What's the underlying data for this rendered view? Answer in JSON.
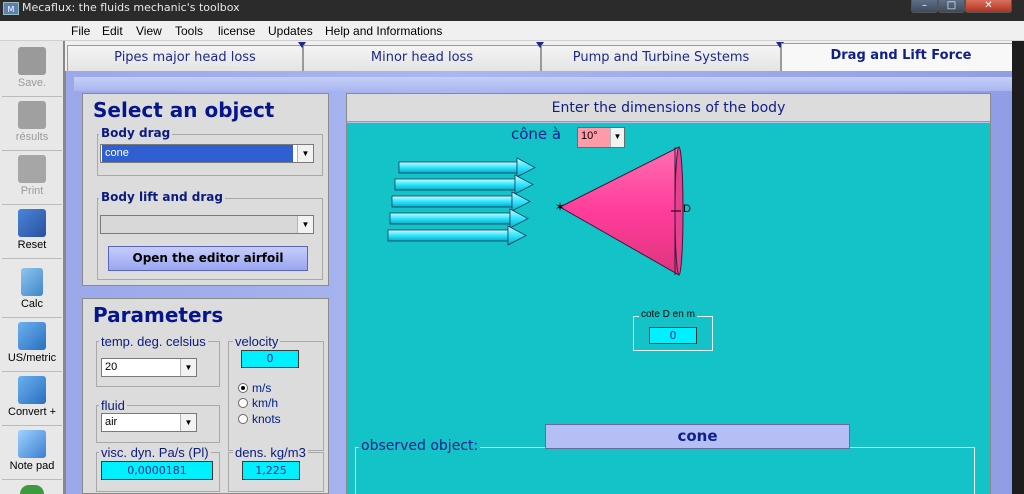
{
  "window": {
    "title": "Mecaflux: the fluids mechanic's toolbox",
    "icon_text": "M"
  },
  "menu": [
    "File",
    "Edit",
    "View",
    "Tools",
    "license",
    "Updates",
    "Help and Informations"
  ],
  "toolbar": [
    {
      "label": "Save.",
      "icon": "save-icon",
      "enabled": false
    },
    {
      "label": "résults",
      "icon": "results-icon",
      "enabled": false
    },
    {
      "label": "Print",
      "icon": "print-icon",
      "enabled": false
    },
    {
      "label": "Reset",
      "icon": "reset-icon",
      "enabled": true
    },
    {
      "label": "Calc",
      "icon": "calculator-icon",
      "enabled": true
    },
    {
      "label": "US/metric",
      "icon": "us-metric-icon",
      "enabled": true
    },
    {
      "label": "Convert +",
      "icon": "convert-icon",
      "enabled": true
    },
    {
      "label": "Note pad",
      "icon": "notepad-icon",
      "enabled": true
    }
  ],
  "tabs": [
    {
      "label": "Pipes major head loss",
      "active": false
    },
    {
      "label": "Minor head loss",
      "active": false
    },
    {
      "label": "Pump and Turbine Systems",
      "active": false
    },
    {
      "label": "Drag and Lift Force",
      "active": true
    }
  ],
  "select_object": {
    "title": "Select an object",
    "body_drag_label": "Body drag",
    "body_drag_value": "cone",
    "body_lift_label": "Body lift and drag",
    "body_lift_value": "",
    "editor_button": "Open the editor airfoil"
  },
  "parameters": {
    "title": "Parameters",
    "temp_label": "temp. deg. celsius",
    "temp_value": "20",
    "velocity_label": "velocity",
    "velocity_value": "0",
    "units": [
      {
        "label": "m/s",
        "selected": true
      },
      {
        "label": "km/h",
        "selected": false
      },
      {
        "label": "knots",
        "selected": false
      }
    ],
    "fluid_label": "fluid",
    "fluid_value": "air",
    "visc_label": "visc. dyn. Pa/s  (Pl)",
    "visc_value": "0,0000181",
    "dens_label": "dens. kg/m3",
    "dens_value": "1,225"
  },
  "body": {
    "header": "Enter the dimensions of the body",
    "cone_label": "cône à",
    "cone_angle": "10°",
    "dim_label": "D",
    "cote_label": "cote D en m",
    "cote_value": "0"
  },
  "observed": {
    "label": "observed object:",
    "value": "cone"
  },
  "colors": {
    "accent": "#06158c",
    "canvas": "#14c3c8",
    "cone": "#ff4fa3",
    "arrow": "#2fe6ff",
    "main_bg": "#a3b0ee",
    "input_cyan": "#00f0ff"
  }
}
